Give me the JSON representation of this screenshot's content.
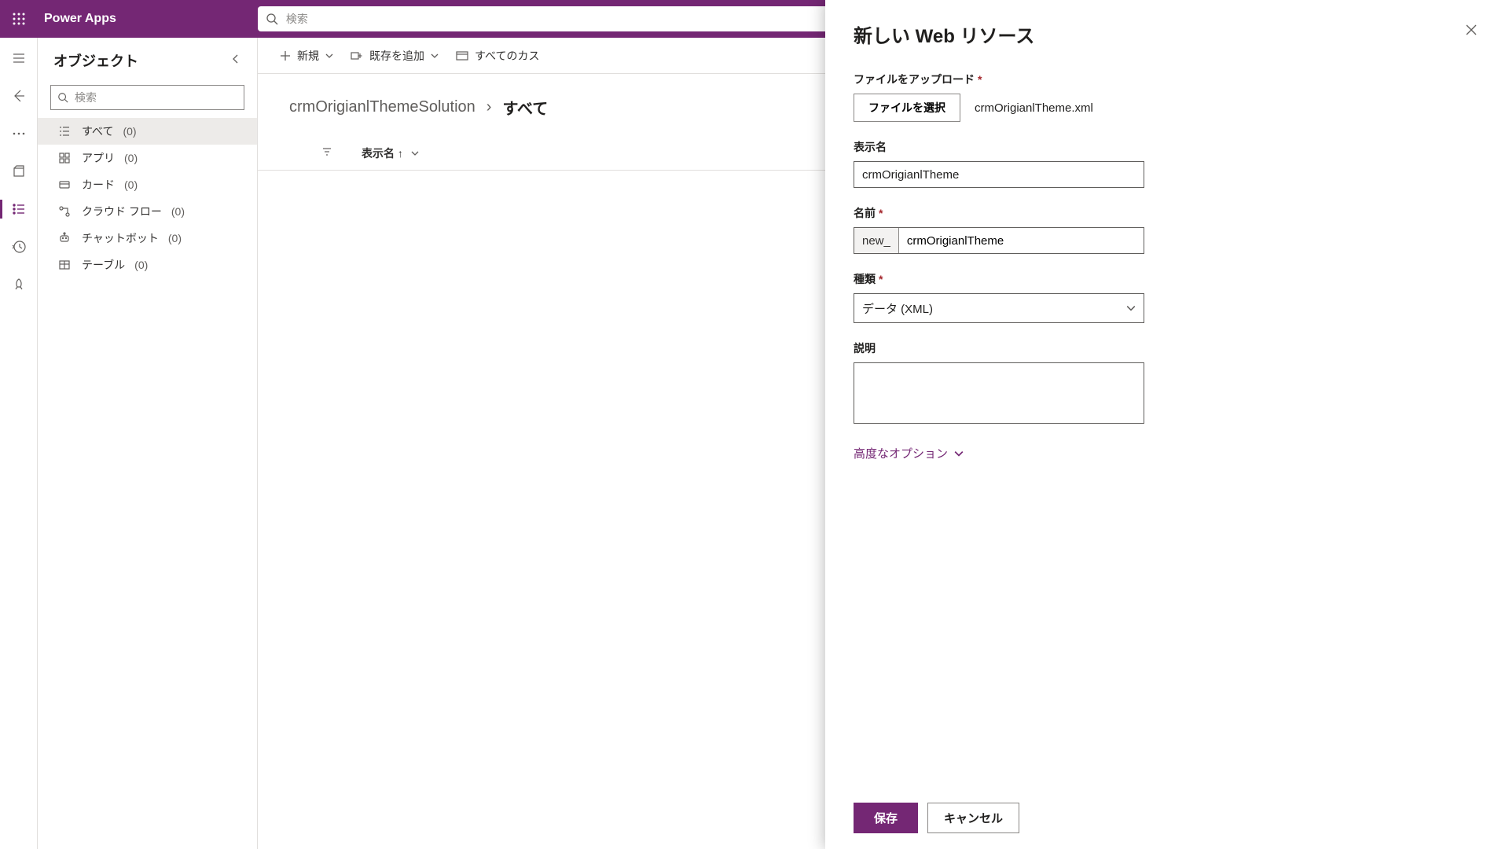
{
  "header": {
    "app_title": "Power Apps",
    "search_placeholder": "検索"
  },
  "sidebar": {
    "title": "オブジェクト",
    "search_placeholder": "検索",
    "items": [
      {
        "label": "すべて",
        "count": "(0)"
      },
      {
        "label": "アプリ",
        "count": "(0)"
      },
      {
        "label": "カード",
        "count": "(0)"
      },
      {
        "label": "クラウド フロー",
        "count": "(0)"
      },
      {
        "label": "チャットボット",
        "count": "(0)"
      },
      {
        "label": "テーブル",
        "count": "(0)"
      }
    ]
  },
  "toolbar": {
    "new": "新規",
    "add_existing": "既存を追加",
    "all_custom": "すべてのカス"
  },
  "breadcrumb": {
    "root": "crmOrigianlThemeSolution",
    "current": "すべて"
  },
  "table": {
    "column_display_name": "表示名 ↑"
  },
  "drawer": {
    "title": "新しい Web リソース",
    "upload_label": "ファイルをアップロード",
    "choose_file": "ファイルを選択",
    "file_name": "crmOrigianlTheme.xml",
    "display_name_label": "表示名",
    "display_name_value": "crmOrigianlTheme",
    "name_label": "名前",
    "name_prefix": "new_",
    "name_value": "crmOrigianlTheme",
    "type_label": "種類",
    "type_value": "データ (XML)",
    "description_label": "説明",
    "description_value": "",
    "advanced": "高度なオプション",
    "save": "保存",
    "cancel": "キャンセル"
  }
}
